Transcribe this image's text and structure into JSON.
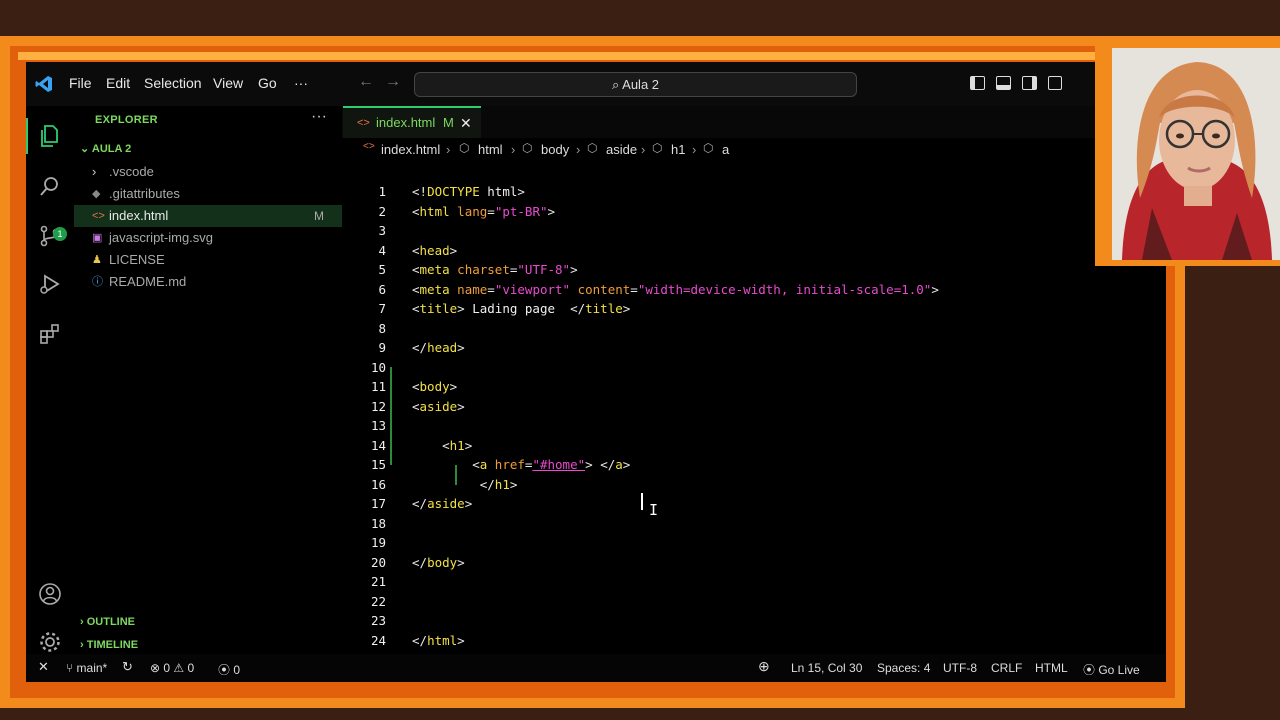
{
  "titlebar": {
    "menus": [
      "File",
      "Edit",
      "Selection",
      "View",
      "Go",
      "···"
    ],
    "search": "Aula 2"
  },
  "explorer": {
    "title": "EXPLORER",
    "more": "···",
    "folder": "AULA 2",
    "items": [
      {
        "label": ".vscode",
        "icon": "chevron-right-icon",
        "status": ""
      },
      {
        "label": ".gitattributes",
        "icon": "git-file-icon",
        "status": ""
      },
      {
        "label": "index.html",
        "icon": "html-file-icon",
        "status": "M"
      },
      {
        "label": "javascript-img.svg",
        "icon": "svg-file-icon",
        "status": ""
      },
      {
        "label": "LICENSE",
        "icon": "license-file-icon",
        "status": ""
      },
      {
        "label": "README.md",
        "icon": "info-file-icon",
        "status": ""
      }
    ],
    "outline": "OUTLINE",
    "timeline": "TIMELINE"
  },
  "tab": {
    "name": "index.html",
    "status": "M",
    "close": "✕"
  },
  "breadcrumb": [
    "index.html",
    "html",
    "body",
    "aside",
    "h1",
    "a"
  ],
  "source_control_badge": "1",
  "code_lines": [
    {
      "n": "1",
      "tokens": [
        [
          "tg",
          "<!"
        ],
        [
          "el",
          "DOCTYPE"
        ],
        [
          "tx",
          " html"
        ],
        [
          "tg",
          ">"
        ]
      ]
    },
    {
      "n": "2",
      "tokens": [
        [
          "tg",
          "<"
        ],
        [
          "el",
          "html"
        ],
        [
          "at",
          " lang"
        ],
        [
          "tg",
          "="
        ],
        [
          "st",
          "\"pt-BR\""
        ],
        [
          "tg",
          ">"
        ]
      ]
    },
    {
      "n": "3",
      "tokens": []
    },
    {
      "n": "4",
      "tokens": [
        [
          "tg",
          "<"
        ],
        [
          "el",
          "head"
        ],
        [
          "tg",
          ">"
        ]
      ]
    },
    {
      "n": "5",
      "tokens": [
        [
          "tg",
          "<"
        ],
        [
          "el",
          "meta"
        ],
        [
          "at",
          " charset"
        ],
        [
          "tg",
          "="
        ],
        [
          "st",
          "\"UTF-8\""
        ],
        [
          "tg",
          ">"
        ]
      ]
    },
    {
      "n": "6",
      "tokens": [
        [
          "tg",
          "<"
        ],
        [
          "el",
          "meta"
        ],
        [
          "at",
          " name"
        ],
        [
          "tg",
          "="
        ],
        [
          "st",
          "\"viewport\""
        ],
        [
          "at",
          " content"
        ],
        [
          "tg",
          "="
        ],
        [
          "st",
          "\"width=device-width, initial-scale=1.0\""
        ],
        [
          "tg",
          ">"
        ]
      ]
    },
    {
      "n": "7",
      "tokens": [
        [
          "tg",
          "<"
        ],
        [
          "el",
          "title"
        ],
        [
          "tg",
          ">"
        ],
        [
          "tx",
          " Lading page  "
        ],
        [
          "tg",
          "</"
        ],
        [
          "el",
          "title"
        ],
        [
          "tg",
          ">"
        ]
      ]
    },
    {
      "n": "8",
      "tokens": []
    },
    {
      "n": "9",
      "tokens": [
        [
          "tg",
          "</"
        ],
        [
          "el",
          "head"
        ],
        [
          "tg",
          ">"
        ]
      ]
    },
    {
      "n": "10",
      "tokens": []
    },
    {
      "n": "11",
      "tokens": [
        [
          "tg",
          "<"
        ],
        [
          "el",
          "body"
        ],
        [
          "tg",
          ">"
        ]
      ]
    },
    {
      "n": "12",
      "tokens": [
        [
          "tg",
          "<"
        ],
        [
          "el",
          "aside"
        ],
        [
          "tg",
          ">"
        ]
      ]
    },
    {
      "n": "13",
      "tokens": []
    },
    {
      "n": "14",
      "tokens": [
        [
          "tx",
          "    "
        ],
        [
          "tg",
          "<"
        ],
        [
          "el",
          "h1"
        ],
        [
          "tg",
          ">"
        ]
      ]
    },
    {
      "n": "15",
      "tokens": [
        [
          "tx",
          "        "
        ],
        [
          "tg",
          "<"
        ],
        [
          "el",
          "a"
        ],
        [
          "at",
          " href"
        ],
        [
          "tg",
          "="
        ],
        [
          "st",
          "\"#home\""
        ],
        [
          "tg",
          "> </"
        ],
        [
          "el",
          "a"
        ],
        [
          "tg",
          ">"
        ]
      ]
    },
    {
      "n": "16",
      "tokens": [
        [
          "tx",
          "         "
        ],
        [
          "tg",
          "</"
        ],
        [
          "el",
          "h1"
        ],
        [
          "tg",
          ">"
        ]
      ]
    },
    {
      "n": "17",
      "tokens": [
        [
          "tg",
          "</"
        ],
        [
          "el",
          "aside"
        ],
        [
          "tg",
          ">"
        ]
      ]
    },
    {
      "n": "18",
      "tokens": []
    },
    {
      "n": "19",
      "tokens": []
    },
    {
      "n": "20",
      "tokens": [
        [
          "tg",
          "</"
        ],
        [
          "el",
          "body"
        ],
        [
          "tg",
          ">"
        ]
      ]
    },
    {
      "n": "21",
      "tokens": []
    },
    {
      "n": "22",
      "tokens": []
    },
    {
      "n": "23",
      "tokens": []
    },
    {
      "n": "24",
      "tokens": [
        [
          "tg",
          "</"
        ],
        [
          "el",
          "html"
        ],
        [
          "tg",
          ">"
        ]
      ]
    }
  ],
  "statusbar": {
    "branch": "main*",
    "errors": "0",
    "warnings": "0",
    "ports": "0",
    "position": "Ln 15, Col 30",
    "spaces": "Spaces: 4",
    "encoding": "UTF-8",
    "eol": "CRLF",
    "language": "HTML",
    "live": "Go Live"
  }
}
